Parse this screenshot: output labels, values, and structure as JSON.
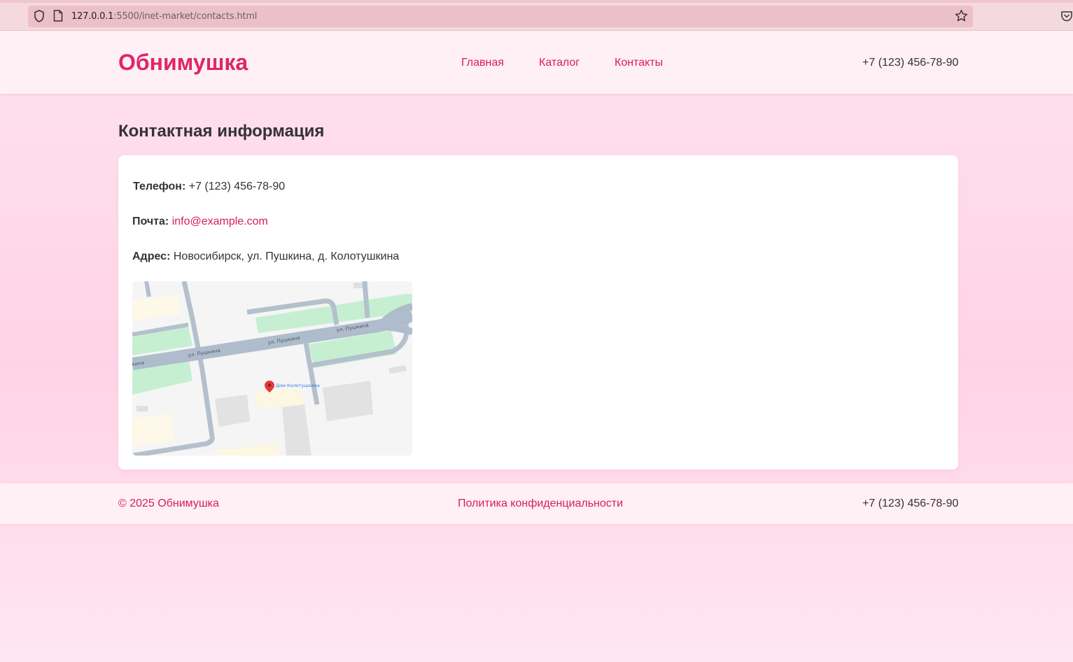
{
  "browser": {
    "url_host": "127.0.0.1",
    "url_rest": ":5500/inet-market/contacts.html"
  },
  "header": {
    "logo": "Обнимушка",
    "nav": [
      {
        "label": "Главная"
      },
      {
        "label": "Каталог"
      },
      {
        "label": "Контакты"
      }
    ],
    "phone": "+7 (123) 456-78-90"
  },
  "main": {
    "title": "Контактная информация",
    "phone_label": "Телефон:",
    "phone_value": "+7 (123) 456-78-90",
    "email_label": "Почта:",
    "email_value": "info@example.com",
    "address_label": "Адрес:",
    "address_value": "Новосибирск, ул. Пушкина, д. Колотушкина",
    "map": {
      "street_label": "ул. Пушкина",
      "street_label_left": "кина",
      "place_label": "Дом Колотушкина"
    }
  },
  "footer": {
    "copyright": "© 2025 Обнимушка",
    "privacy": "Политика конфиденциальности",
    "phone": "+7 (123) 456-78-90"
  },
  "colors": {
    "accent": "#e0246a",
    "link": "#d81b60",
    "background": "#ffd9e8",
    "header_bg": "#fff0f5"
  }
}
